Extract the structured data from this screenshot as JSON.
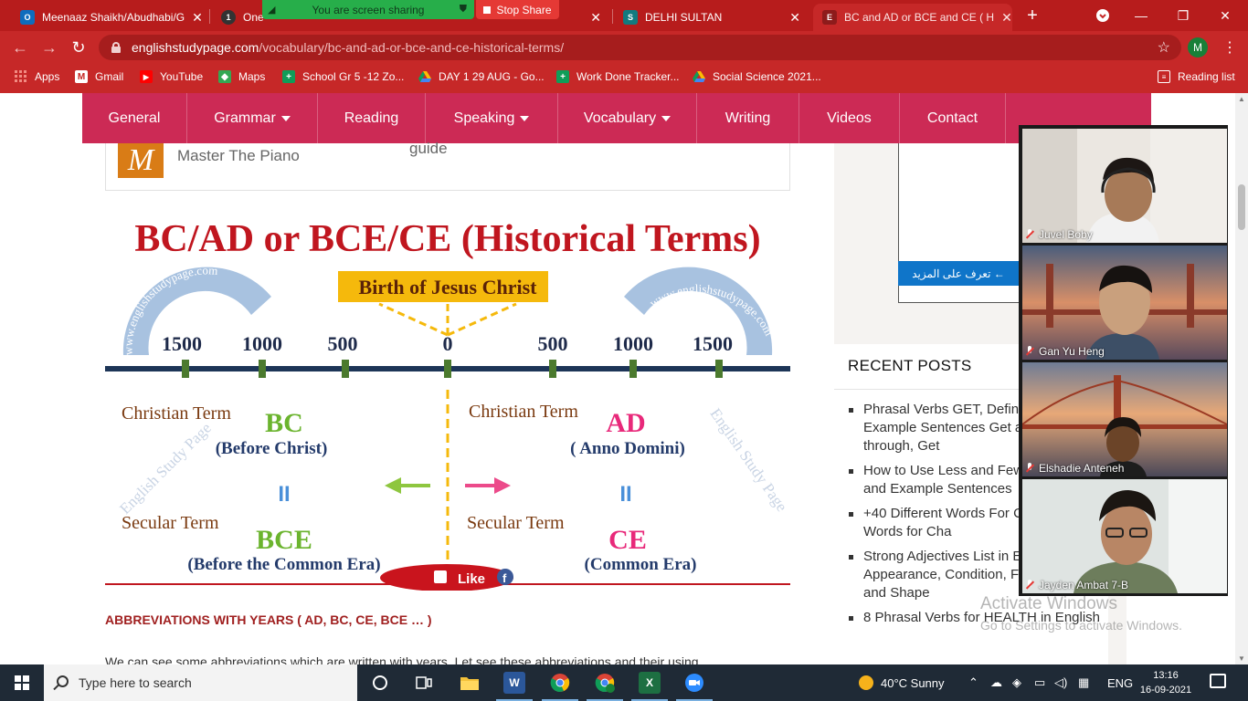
{
  "browser": {
    "tabs": [
      {
        "label": "Meenaaz Shaikh/Abudhabi/G",
        "icon": "outlook-icon",
        "color": "#0f6cbd"
      },
      {
        "label": "One",
        "icon": "onenote-icon",
        "color": "#333333"
      },
      {
        "label": "DELHI SULTAN",
        "icon": "sway-icon",
        "color": "#137a7f"
      },
      {
        "label": "BC and AD or BCE and CE ( H",
        "icon": "englishstudypage-icon",
        "color": "#c62828"
      }
    ],
    "screen_share": {
      "banner": "You are screen sharing",
      "stop": "Stop Share"
    },
    "url_domain": "englishstudypage.com",
    "url_path": "/vocabulary/bc-and-ad-or-bce-and-ce-historical-terms/",
    "profile_initial": "M",
    "bookmarks": [
      {
        "label": "Apps",
        "icon": "apps-grid-icon"
      },
      {
        "label": "Gmail",
        "icon": "gmail-icon"
      },
      {
        "label": "YouTube",
        "icon": "youtube-icon"
      },
      {
        "label": "Maps",
        "icon": "maps-icon"
      },
      {
        "label": "School Gr 5 -12 Zo...",
        "icon": "google-sheets-icon"
      },
      {
        "label": "DAY 1 29 AUG - Go...",
        "icon": "google-drive-icon"
      },
      {
        "label": "Work Done Tracker...",
        "icon": "google-sheets-icon"
      },
      {
        "label": "Social Science 2021...",
        "icon": "google-drive-icon"
      }
    ],
    "reading_list": "Reading list"
  },
  "site": {
    "menu": [
      {
        "label": "General",
        "dropdown": false
      },
      {
        "label": "Grammar",
        "dropdown": true
      },
      {
        "label": "Reading",
        "dropdown": false
      },
      {
        "label": "Speaking",
        "dropdown": true
      },
      {
        "label": "Vocabulary",
        "dropdown": true
      },
      {
        "label": "Writing",
        "dropdown": false
      },
      {
        "label": "Videos",
        "dropdown": false
      },
      {
        "label": "Contact",
        "dropdown": false
      }
    ],
    "brand_color": "#cc2a55"
  },
  "ad": {
    "logo": "M",
    "name": "Master The Piano",
    "guide": "guide"
  },
  "infographic": {
    "title": "BC/AD or BCE/CE (Historical Terms)",
    "center_label": "Birth of Jesus Christ",
    "watermark_arc": "www.englishstudypage.com",
    "watermark_side": "English Study Page",
    "ticks_left": [
      "1500",
      "1000",
      "500"
    ],
    "tick_zero": "0",
    "ticks_right": [
      "500",
      "1000",
      "1500"
    ],
    "left": {
      "christian_term": "Christian Term",
      "abbr": "BC",
      "meaning": "(Before Christ)",
      "secular_term": "Secular Term",
      "secular_abbr": "BCE",
      "secular_meaning": "(Before the Common Era)"
    },
    "right": {
      "christian_term": "Christian Term",
      "abbr": "AD",
      "meaning": "( Anno Domini)",
      "secular_term": "Secular Term",
      "secular_abbr": "CE",
      "secular_meaning": "(Common Era)"
    },
    "equals": "II",
    "like_button": "Like",
    "facebook_glyph": "f"
  },
  "article": {
    "heading": "ABBREVIATIONS WITH YEARS ( AD, BC, CE, BCE … )",
    "paragraph": "We can see some abbreviations which are written with years. Let see these abbreviations and their using"
  },
  "sidebar": {
    "arabic_button": "تعرف على المزيد ←",
    "recent_title": "RECENT POSTS",
    "recent_posts": [
      "Phrasal Verbs GET, Definition and Example Sentences Get around, Get through, Get",
      "How to Use Less and Fewer, Definition and Example Sentences",
      "+40 Different Words For Cute, Synonym Words for Cha",
      "Strong Adjectives List in English, Appearance, Condition, Feelings, Size and Shape",
      "8 Phrasal Verbs for HEALTH in English"
    ]
  },
  "watermark": {
    "line1": "Activate Windows",
    "line2": "Go to Settings to activate Windows."
  },
  "video_call": {
    "participants": [
      "Juvel Boby",
      "Gan Yu Heng",
      "Elshadie Anteneh",
      "Jayden Ambat 7-B"
    ]
  },
  "taskbar": {
    "search_placeholder": "Type here to search",
    "weather": "40°C  Sunny",
    "language": "ENG",
    "time": "13:16",
    "date": "16-09-2021"
  }
}
